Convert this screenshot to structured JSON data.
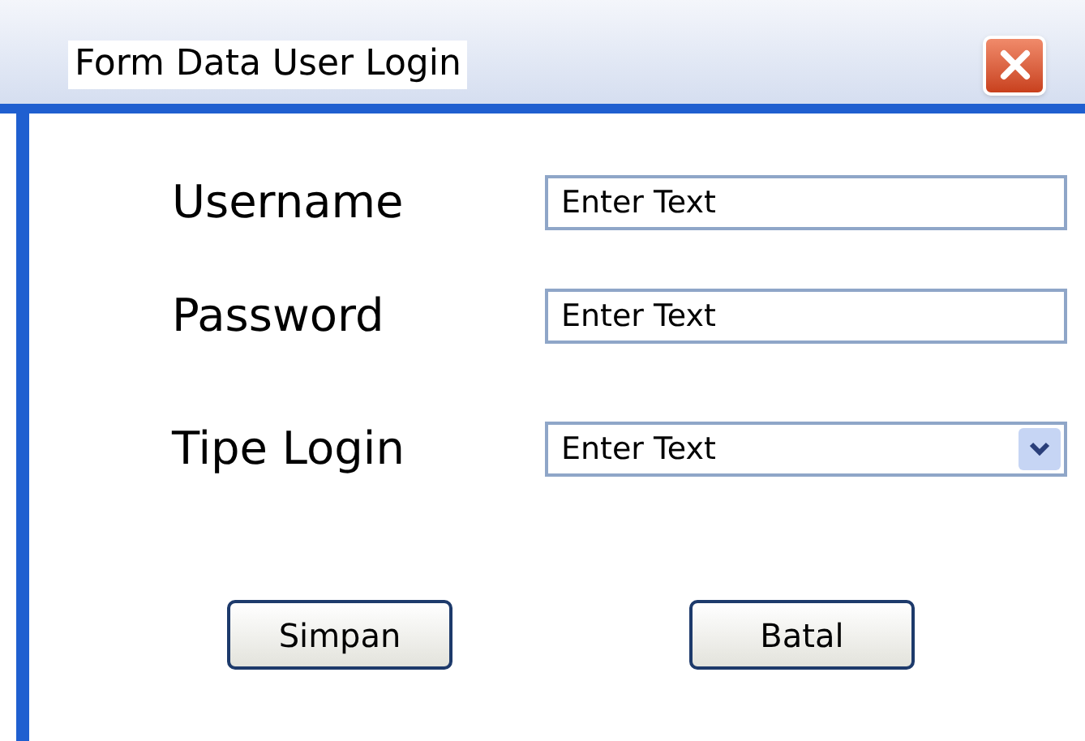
{
  "window": {
    "title": "Form Data User Login"
  },
  "fields": [
    {
      "kind": "text",
      "label": "Username",
      "placeholder": "Enter Text"
    },
    {
      "kind": "text",
      "label": "Password",
      "placeholder": "Enter Text"
    },
    {
      "kind": "select",
      "label": "Tipe Login",
      "placeholder": "Enter Text"
    }
  ],
  "buttons": [
    "Simpan",
    "Batal"
  ]
}
